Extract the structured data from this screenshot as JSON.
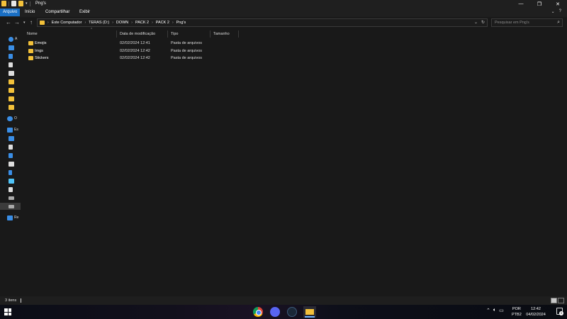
{
  "window": {
    "title": "Png's",
    "controls": [
      "minimize-icon",
      "maximize-icon",
      "close-icon"
    ]
  },
  "ribbon": {
    "tabs": [
      {
        "label": "Arquivo",
        "active": true
      },
      {
        "label": "Início",
        "active": false
      },
      {
        "label": "Compartilhar",
        "active": false
      },
      {
        "label": "Exibir",
        "active": false
      }
    ]
  },
  "address": {
    "breadcrumbs": [
      "Este Computador",
      "TERAS (D:)",
      "DOWN",
      "PACK 2",
      "PACK 2",
      "Png's"
    ],
    "search_placeholder": "Pesquisar em Png's"
  },
  "navpane": {
    "items": [
      {
        "label": "A",
        "icon": "star-icon",
        "color": "#3a8ee6"
      },
      {
        "label": "",
        "icon": "desktop-icon",
        "color": "#3a8ee6"
      },
      {
        "label": "",
        "icon": "download-icon",
        "color": "#3a8ee6"
      },
      {
        "label": "",
        "icon": "document-icon",
        "color": "#dddddd"
      },
      {
        "label": "",
        "icon": "image-icon",
        "color": "#dddddd"
      },
      {
        "label": "",
        "icon": "folder-icon",
        "color": "#f3c13a"
      },
      {
        "label": "",
        "icon": "folder-icon",
        "color": "#f3c13a"
      },
      {
        "label": "",
        "icon": "folder-icon",
        "color": "#f3c13a"
      },
      {
        "label": "",
        "icon": "folder-icon",
        "color": "#f3c13a"
      },
      {
        "label": "O",
        "icon": "onedrive-icon",
        "color": "#3a8ee6"
      },
      {
        "label": "Es",
        "icon": "computer-icon",
        "color": "#3a8ee6"
      },
      {
        "label": "",
        "icon": "desktop-icon",
        "color": "#3a8ee6"
      },
      {
        "label": "",
        "icon": "document-icon",
        "color": "#dddddd"
      },
      {
        "label": "",
        "icon": "download-icon",
        "color": "#3a8ee6"
      },
      {
        "label": "",
        "icon": "image-icon",
        "color": "#dddddd"
      },
      {
        "label": "",
        "icon": "music-icon",
        "color": "#3a8ee6"
      },
      {
        "label": "",
        "icon": "3d-objects-icon",
        "color": "#4fc3f7"
      },
      {
        "label": "",
        "icon": "video-icon",
        "color": "#dddddd"
      },
      {
        "label": "",
        "icon": "drive-icon",
        "color": "#aaaaaa"
      },
      {
        "label": "",
        "icon": "drive-icon",
        "color": "#aaaaaa"
      },
      {
        "label": "Re",
        "icon": "network-icon",
        "color": "#3a8ee6"
      }
    ]
  },
  "table": {
    "columns": [
      "Nome",
      "Data de modificação",
      "Tipo",
      "Tamanho"
    ],
    "rows": [
      {
        "name": "Emojis",
        "date": "02/02/2024 12:41",
        "type": "Pasta de arquivos",
        "size": ""
      },
      {
        "name": "Imgs",
        "date": "02/02/2024 12:42",
        "type": "Pasta de arquivos",
        "size": ""
      },
      {
        "name": "Stickers",
        "date": "02/02/2024 12:42",
        "type": "Pasta de arquivos",
        "size": ""
      }
    ]
  },
  "status": {
    "item_count": "3 itens"
  },
  "taskbar": {
    "apps": [
      "chrome-icon",
      "discord-icon",
      "steam-icon",
      "file-explorer-icon"
    ],
    "language": "POR",
    "keyboard": "PTB2",
    "time": "12:42",
    "date": "04/02/2024",
    "notification_count": "9"
  },
  "colors": {
    "accent": "#1a6fc4",
    "folder": "#f3c13a",
    "background": "#191919"
  }
}
